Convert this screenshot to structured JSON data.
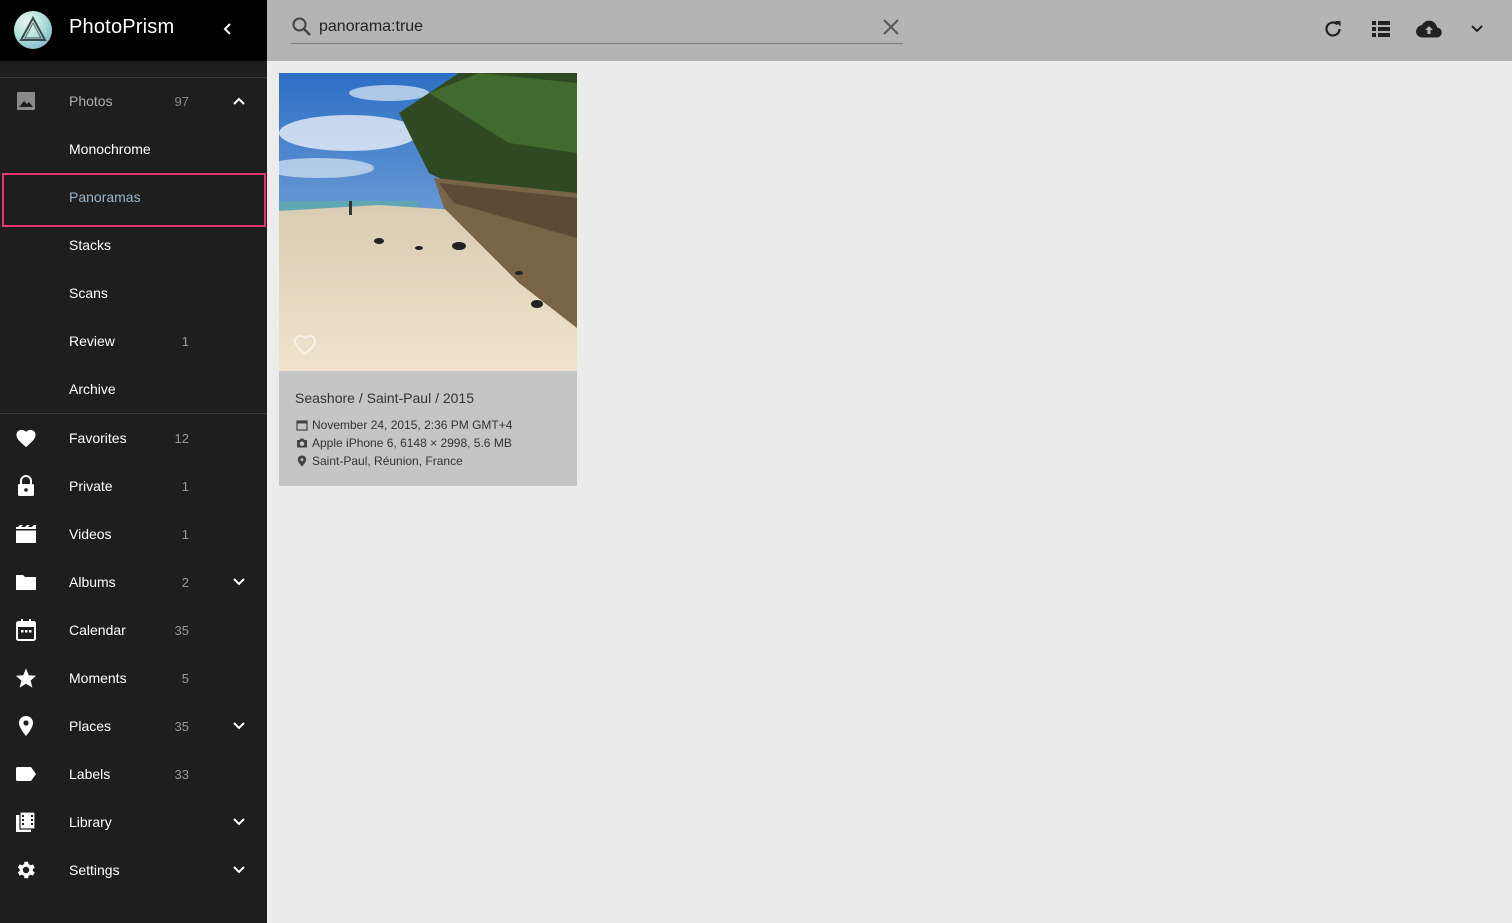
{
  "app": {
    "title": "PhotoPrism"
  },
  "sidebar": {
    "photos": {
      "label": "Photos",
      "count": "97"
    },
    "subitems": [
      {
        "label": "Monochrome",
        "count": ""
      },
      {
        "label": "Panoramas",
        "count": ""
      },
      {
        "label": "Stacks",
        "count": ""
      },
      {
        "label": "Scans",
        "count": ""
      },
      {
        "label": "Review",
        "count": "1"
      },
      {
        "label": "Archive",
        "count": ""
      }
    ],
    "items": [
      {
        "label": "Favorites",
        "count": "12",
        "icon": "heart-icon"
      },
      {
        "label": "Private",
        "count": "1",
        "icon": "lock-icon"
      },
      {
        "label": "Videos",
        "count": "1",
        "icon": "video-icon"
      },
      {
        "label": "Albums",
        "count": "2",
        "icon": "folder-icon"
      },
      {
        "label": "Calendar",
        "count": "35",
        "icon": "calendar-icon"
      },
      {
        "label": "Moments",
        "count": "5",
        "icon": "star-icon"
      },
      {
        "label": "Places",
        "count": "35",
        "icon": "place-icon"
      },
      {
        "label": "Labels",
        "count": "33",
        "icon": "label-icon"
      },
      {
        "label": "Library",
        "count": "",
        "icon": "library-icon"
      },
      {
        "label": "Settings",
        "count": "",
        "icon": "gear-icon"
      }
    ]
  },
  "search": {
    "value": "panorama:true"
  },
  "card": {
    "title": "Seashore / Saint-Paul / 2015",
    "date": "November 24, 2015, 2:36 PM GMT+4",
    "camera": "Apple iPhone 6, 6148 × 2998, 5.6 MB",
    "location": "Saint-Paul, Réunion, France"
  },
  "colors": {
    "sidebar_bg": "#1e1e1e",
    "topbar_bg": "#b4b4b4",
    "content_bg": "#ececec",
    "highlight": "#e0356f"
  }
}
